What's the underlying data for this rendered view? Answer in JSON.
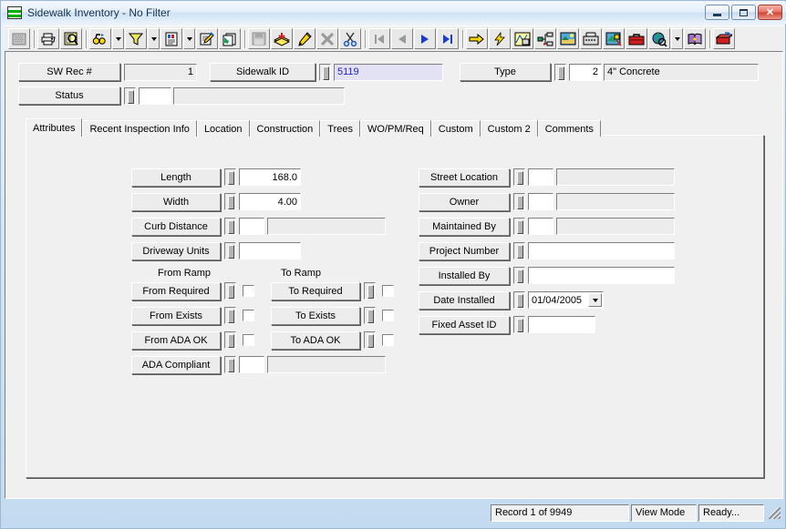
{
  "window": {
    "title": "Sidewalk Inventory - No Filter",
    "icon": "window-grid-icon",
    "minimize_label": "",
    "maximize_label": "",
    "close_label": "✕"
  },
  "toolbar": {
    "buttons": [
      {
        "name": "print-preview-grid-icon",
        "label": "",
        "disabled": true
      },
      {
        "name": "print-icon",
        "label": ""
      },
      {
        "name": "print-preview-icon",
        "label": ""
      },
      {
        "name": "find-icon",
        "label": ""
      },
      {
        "name": "find-dropdown-arrow",
        "label": ""
      },
      {
        "name": "filter-icon",
        "label": ""
      },
      {
        "name": "filter-dropdown-arrow",
        "label": ""
      },
      {
        "name": "report-icon",
        "label": ""
      },
      {
        "name": "report-dropdown-arrow",
        "label": ""
      },
      {
        "name": "properties-icon",
        "label": ""
      },
      {
        "name": "copy-record-icon",
        "label": ""
      },
      {
        "name": "save-icon",
        "label": "",
        "disabled": true
      },
      {
        "name": "new-record-icon",
        "label": ""
      },
      {
        "name": "edit-record-icon",
        "label": ""
      },
      {
        "name": "delete-record-icon",
        "label": "",
        "disabled": true
      },
      {
        "name": "cut-icon",
        "label": ""
      },
      {
        "name": "first-record-icon",
        "label": "",
        "disabled": true
      },
      {
        "name": "previous-record-icon",
        "label": "",
        "disabled": true
      },
      {
        "name": "next-record-icon",
        "label": ""
      },
      {
        "name": "last-record-icon",
        "label": ""
      },
      {
        "name": "goto-icon",
        "label": ""
      },
      {
        "name": "quick-action-icon",
        "label": ""
      },
      {
        "name": "map-icon",
        "label": ""
      },
      {
        "name": "tree-view-icon",
        "label": ""
      },
      {
        "name": "image-icon",
        "label": ""
      },
      {
        "name": "phone-icon",
        "label": ""
      },
      {
        "name": "gis-icon",
        "label": ""
      },
      {
        "name": "toolbox-icon",
        "label": ""
      },
      {
        "name": "web-icon",
        "label": ""
      },
      {
        "name": "web-dropdown-arrow",
        "label": ""
      },
      {
        "name": "help-book-icon",
        "label": ""
      },
      {
        "name": "exit-icon",
        "label": ""
      }
    ]
  },
  "header": {
    "sw_rec": {
      "label": "SW Rec #",
      "value": "1"
    },
    "sidewalk_id": {
      "label": "Sidewalk ID",
      "value": "5119"
    },
    "type": {
      "label": "Type",
      "code": "2",
      "value": "4\" Concrete"
    },
    "status": {
      "label": "Status",
      "code": "",
      "value": ""
    }
  },
  "tabs": [
    {
      "label": "Attributes",
      "active": true
    },
    {
      "label": "Recent Inspection Info",
      "active": false
    },
    {
      "label": "Location",
      "active": false
    },
    {
      "label": "Construction",
      "active": false
    },
    {
      "label": "Trees",
      "active": false
    },
    {
      "label": "WO/PM/Req",
      "active": false
    },
    {
      "label": "Custom",
      "active": false
    },
    {
      "label": "Custom 2",
      "active": false
    },
    {
      "label": "Comments",
      "active": false
    }
  ],
  "attributes": {
    "left_column": [
      {
        "label": "Length",
        "value": "168.0",
        "kind": "number"
      },
      {
        "label": "Width",
        "value": "4.00",
        "kind": "number"
      },
      {
        "label": "Curb Distance",
        "value": "",
        "desc": "",
        "kind": "code-desc"
      },
      {
        "label": "Driveway Units",
        "value": "",
        "kind": "text"
      }
    ],
    "ramp_headers": {
      "from": "From Ramp",
      "to": "To Ramp"
    },
    "ramp_rows": [
      {
        "from_label": "From Required",
        "from_checked": false,
        "to_label": "To Required",
        "to_checked": false
      },
      {
        "from_label": "From Exists",
        "from_checked": false,
        "to_label": "To  Exists",
        "to_checked": false
      },
      {
        "from_label": "From ADA OK",
        "from_checked": false,
        "to_label": "To ADA OK",
        "to_checked": false
      }
    ],
    "ada_compliant": {
      "label": "ADA Compliant",
      "value": "",
      "desc": ""
    },
    "right_column": [
      {
        "label": "Street Location",
        "value": "",
        "desc": "",
        "kind": "code-desc"
      },
      {
        "label": "Owner",
        "value": "",
        "desc": "",
        "kind": "code-desc"
      },
      {
        "label": "Maintained By",
        "value": "",
        "desc": "",
        "kind": "code-desc"
      },
      {
        "label": "Project Number",
        "value": "",
        "kind": "text-wide"
      },
      {
        "label": "Installed By",
        "value": "",
        "kind": "text-wide"
      },
      {
        "label": "Date Installed",
        "value": "01/04/2005",
        "kind": "date"
      },
      {
        "label": "Fixed Asset ID",
        "value": "",
        "kind": "text-short"
      }
    ]
  },
  "statusbar": {
    "record": "Record 1 of 9949",
    "mode": "View Mode",
    "state": "Ready..."
  }
}
